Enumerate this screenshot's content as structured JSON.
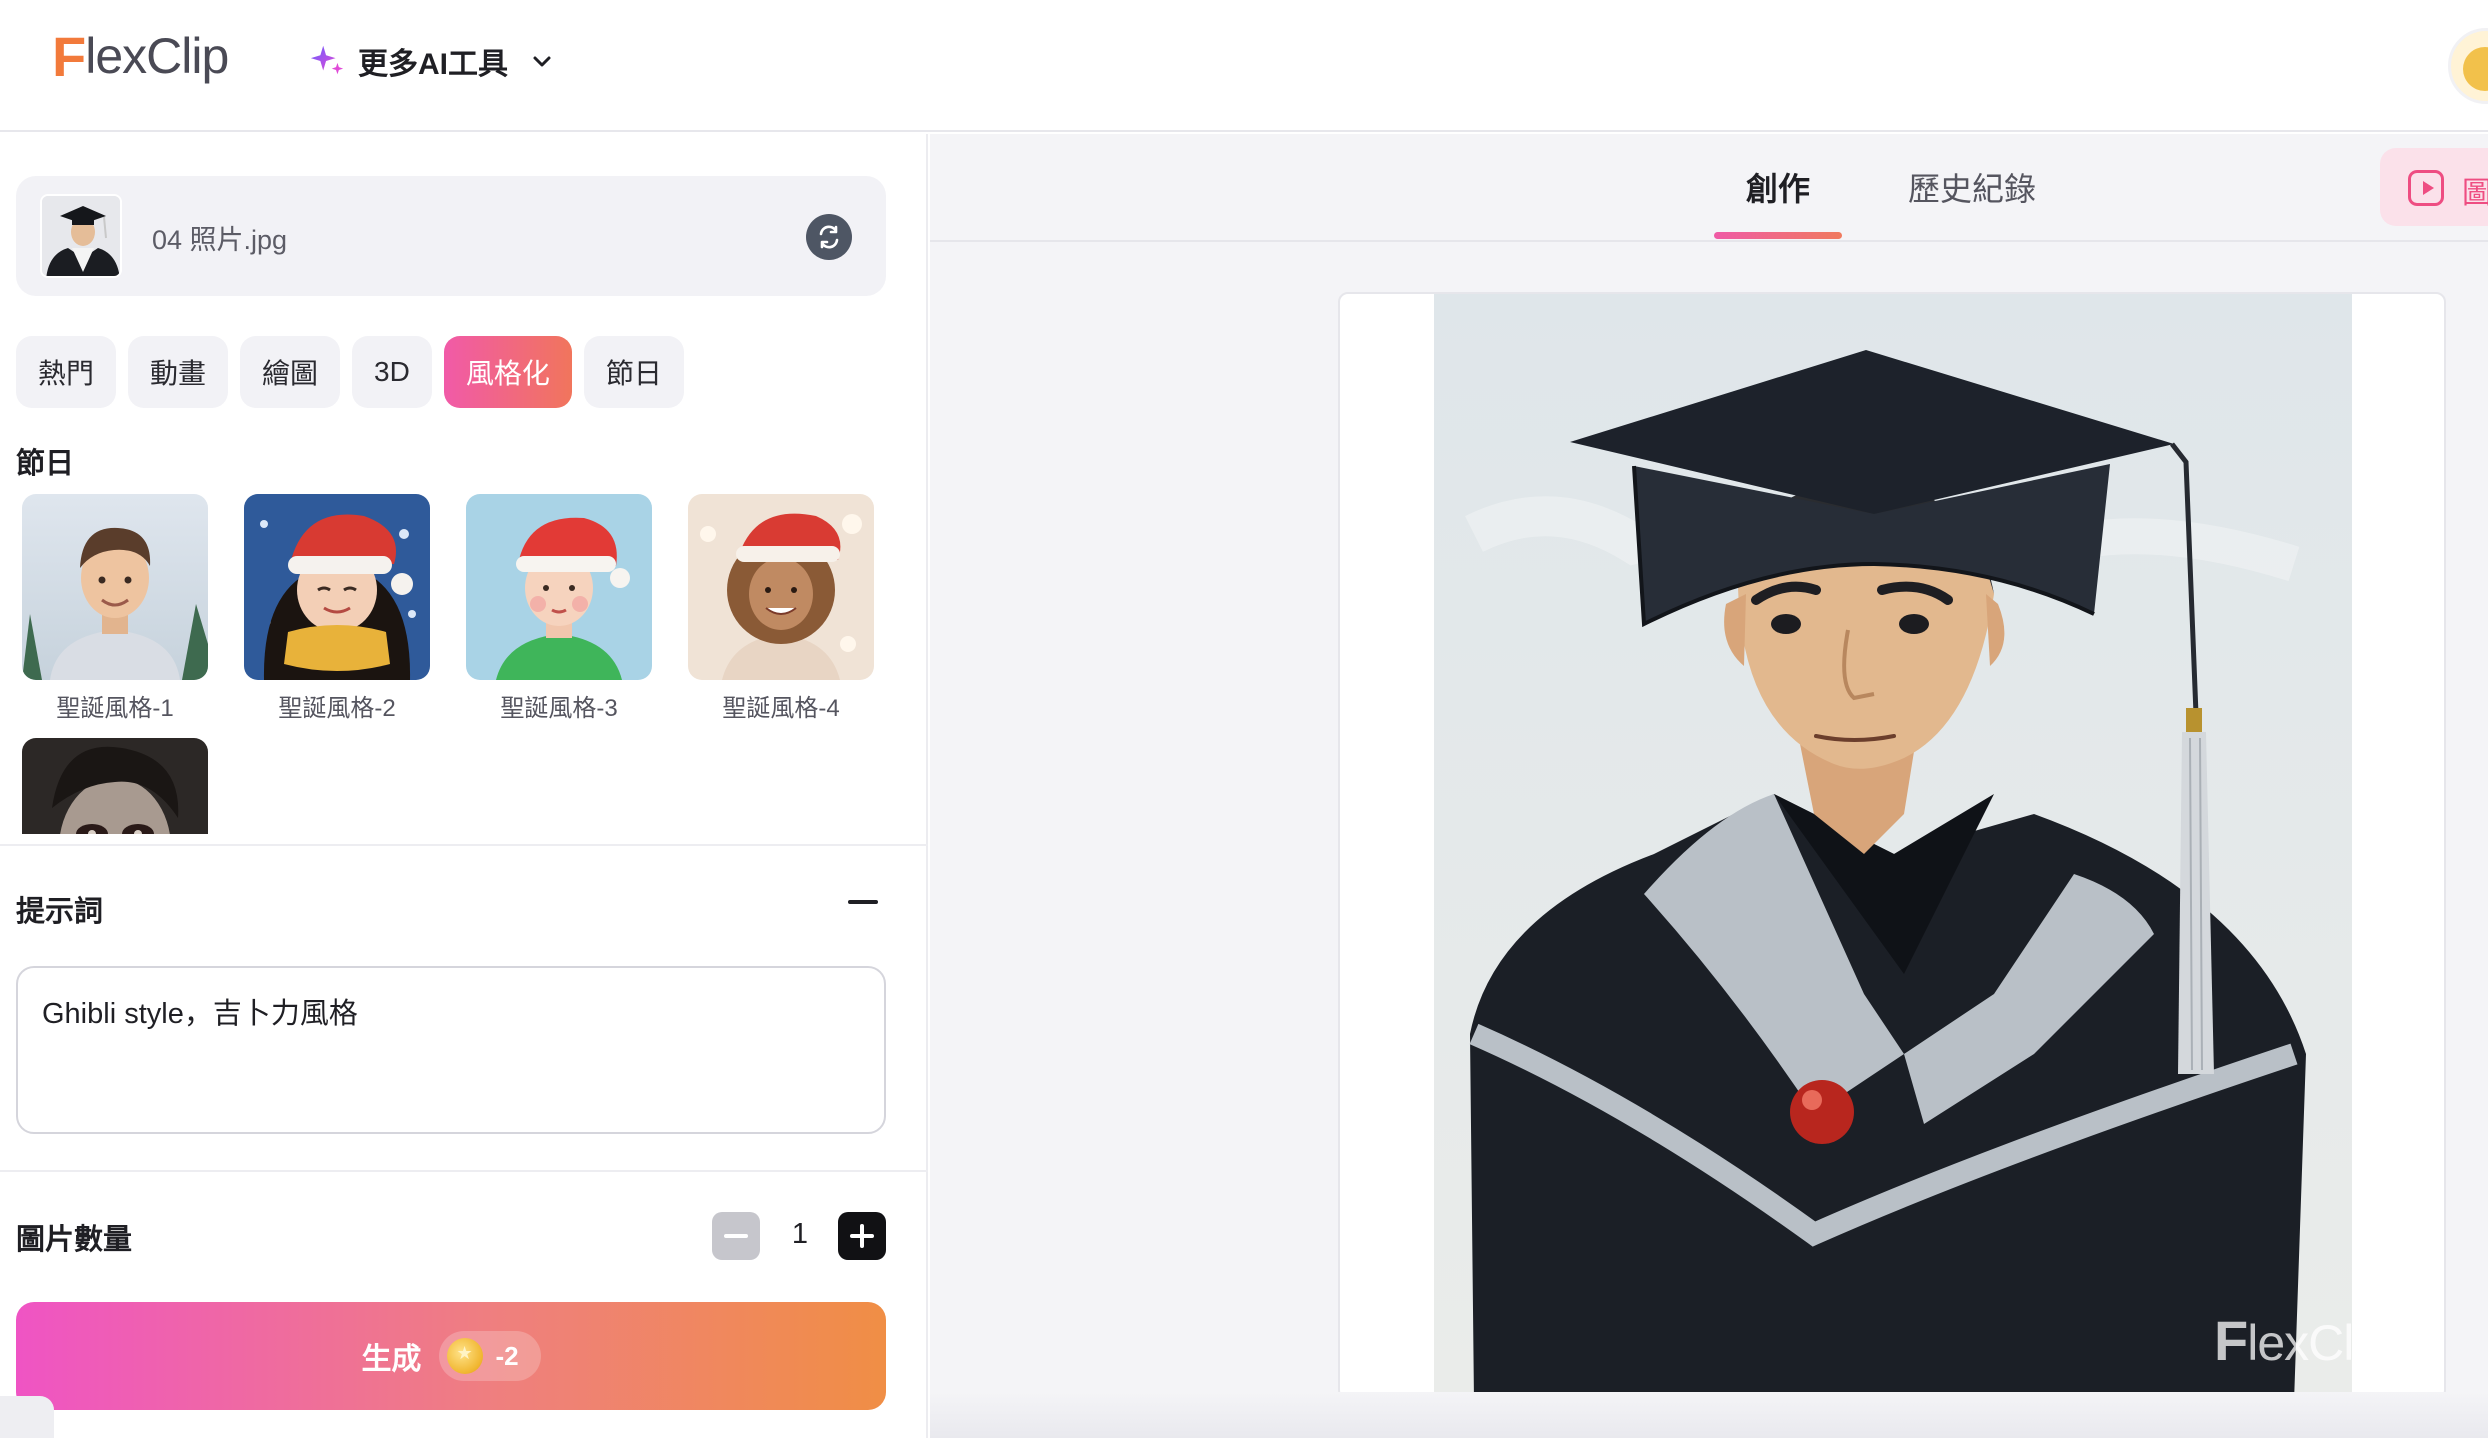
{
  "header": {
    "logo_initial": "F",
    "logo_rest": "lexClip",
    "ai_tools_label": "更多AI工具"
  },
  "upload": {
    "file_name": "04 照片.jpg"
  },
  "category_tabs": [
    {
      "label": "熱門",
      "active": false
    },
    {
      "label": "動畫",
      "active": false
    },
    {
      "label": "繪圖",
      "active": false
    },
    {
      "label": "3D",
      "active": false
    },
    {
      "label": "風格化",
      "active": true
    },
    {
      "label": "節日",
      "active": false
    }
  ],
  "styles_section": {
    "title": "節日",
    "items": [
      {
        "label": "聖誕風格-1",
        "icon": "christmas-boy-thumbnail"
      },
      {
        "label": "聖誕風格-2",
        "icon": "christmas-girl-scarf-thumbnail"
      },
      {
        "label": "聖誕風格-3",
        "icon": "christmas-girl-sweater-thumbnail"
      },
      {
        "label": "聖誕風格-4",
        "icon": "christmas-child-thumbnail"
      },
      {
        "label": "",
        "icon": "halloween-zombie-thumbnail"
      }
    ]
  },
  "prompt": {
    "title": "提示詞",
    "value": "Ghibli style，吉卜力風格"
  },
  "image_count": {
    "title": "圖片數量",
    "value": "1"
  },
  "generate": {
    "label": "生成",
    "cost": "-2"
  },
  "result_tabs": {
    "create": "創作",
    "history": "歷史紀錄",
    "side_button": "圖"
  },
  "result": {
    "watermark_initial": "F",
    "watermark_rest": "lexClip"
  },
  "colors": {
    "accent_gradient_start": "#ef54c4",
    "accent_gradient_end": "#f08e45",
    "active_tab_pink": "#f15aa8",
    "logo_orange": "#f27a3b"
  }
}
